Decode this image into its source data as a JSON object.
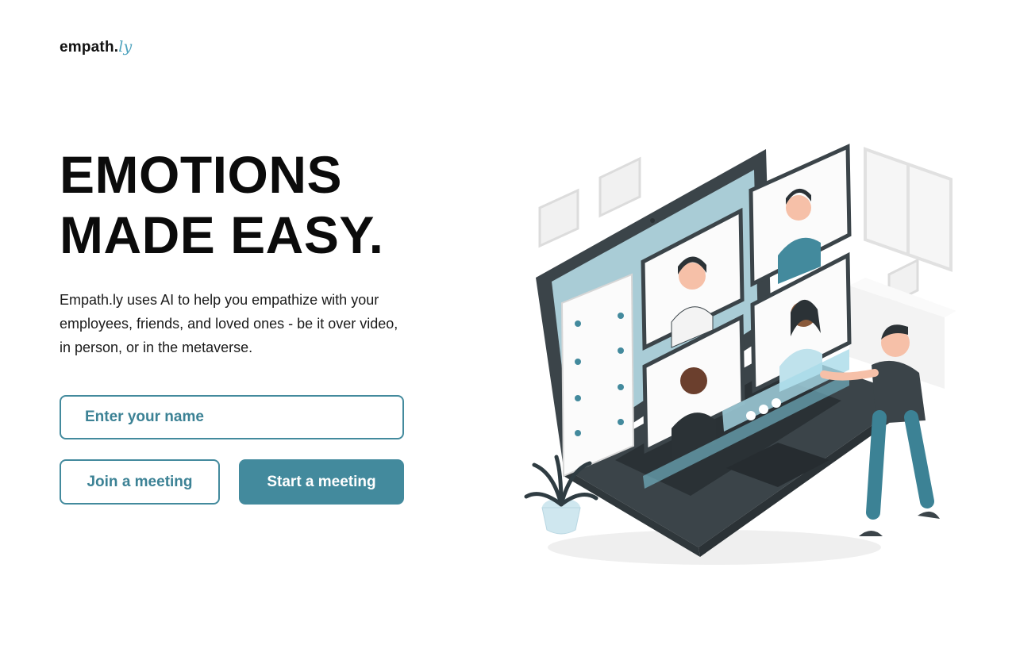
{
  "brand": {
    "name": "empath.",
    "accent": "ly"
  },
  "hero": {
    "headline_line1": "EMOTIONS",
    "headline_line2": "MADE EASY.",
    "description": "Empath.ly uses AI to help you empathize with your employees, friends, and loved ones - be it over video, in person, or in the metaverse."
  },
  "form": {
    "name_placeholder": "Enter your name",
    "name_value": ""
  },
  "actions": {
    "join_label": "Join a meeting",
    "start_label": "Start a meeting"
  },
  "colors": {
    "accent": "#438a9d",
    "logo_accent": "#4fa3be",
    "headline": "#0b0b0b"
  },
  "illustration": {
    "icons": [
      "laptop-icon",
      "video-tile-icon",
      "person-icon",
      "plant-icon",
      "picture-frame-icon"
    ]
  }
}
